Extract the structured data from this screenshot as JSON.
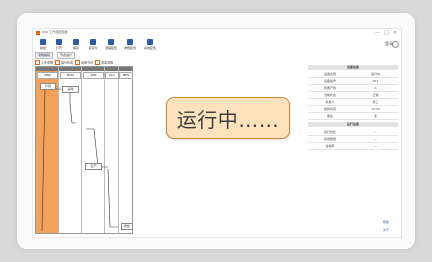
{
  "window": {
    "title": "UCK 工作流配置器",
    "controls": [
      "—",
      "□",
      "✕"
    ]
  },
  "toolbar": [
    {
      "label": "新建",
      "icon": "new-file-icon"
    },
    {
      "label": "打开",
      "icon": "open-folder-icon"
    },
    {
      "label": "保存",
      "icon": "save-icon"
    },
    {
      "label": "另存为",
      "icon": "save-as-icon"
    },
    {
      "label": "流程配置",
      "icon": "flow-config-icon"
    },
    {
      "label": "参数配置",
      "icon": "param-config-icon"
    },
    {
      "label": "系统配置",
      "icon": "system-config-icon"
    }
  ],
  "login": "登录",
  "tabs": [
    "流程编辑",
    "节点设计"
  ],
  "legend": [
    "工序流程",
    "运行状态",
    "设备节点",
    "调度流程"
  ],
  "grid": {
    "sub_headers": [
      "MRP",
      "BOM",
      "WIP",
      "PLC",
      "MES"
    ],
    "boxes": [
      "计划",
      "采购",
      "生产",
      "质检",
      "入库",
      "出库"
    ],
    "bottom_labels": [
      "开始",
      "结束"
    ]
  },
  "panel": {
    "section1": "设备信息",
    "rows1": [
      {
        "k": "设备名称",
        "v": "运行中"
      },
      {
        "k": "设备编号",
        "v": "001"
      },
      {
        "k": "所属产线",
        "v": "A"
      },
      {
        "k": "当前状态",
        "v": "正常"
      },
      {
        "k": "负责人",
        "v": "张三"
      },
      {
        "k": "更新时间",
        "v": "12:00"
      },
      {
        "k": "备注",
        "v": "无"
      }
    ],
    "section2": "运行信息",
    "rows2": [
      {
        "k": "运行时长",
        "v": "—"
      },
      {
        "k": "完成数量",
        "v": "—"
      },
      {
        "k": "合格率",
        "v": "—"
      }
    ]
  },
  "corner_links": [
    "帮助",
    "关于"
  ],
  "overlay": {
    "text": "运行中……"
  }
}
